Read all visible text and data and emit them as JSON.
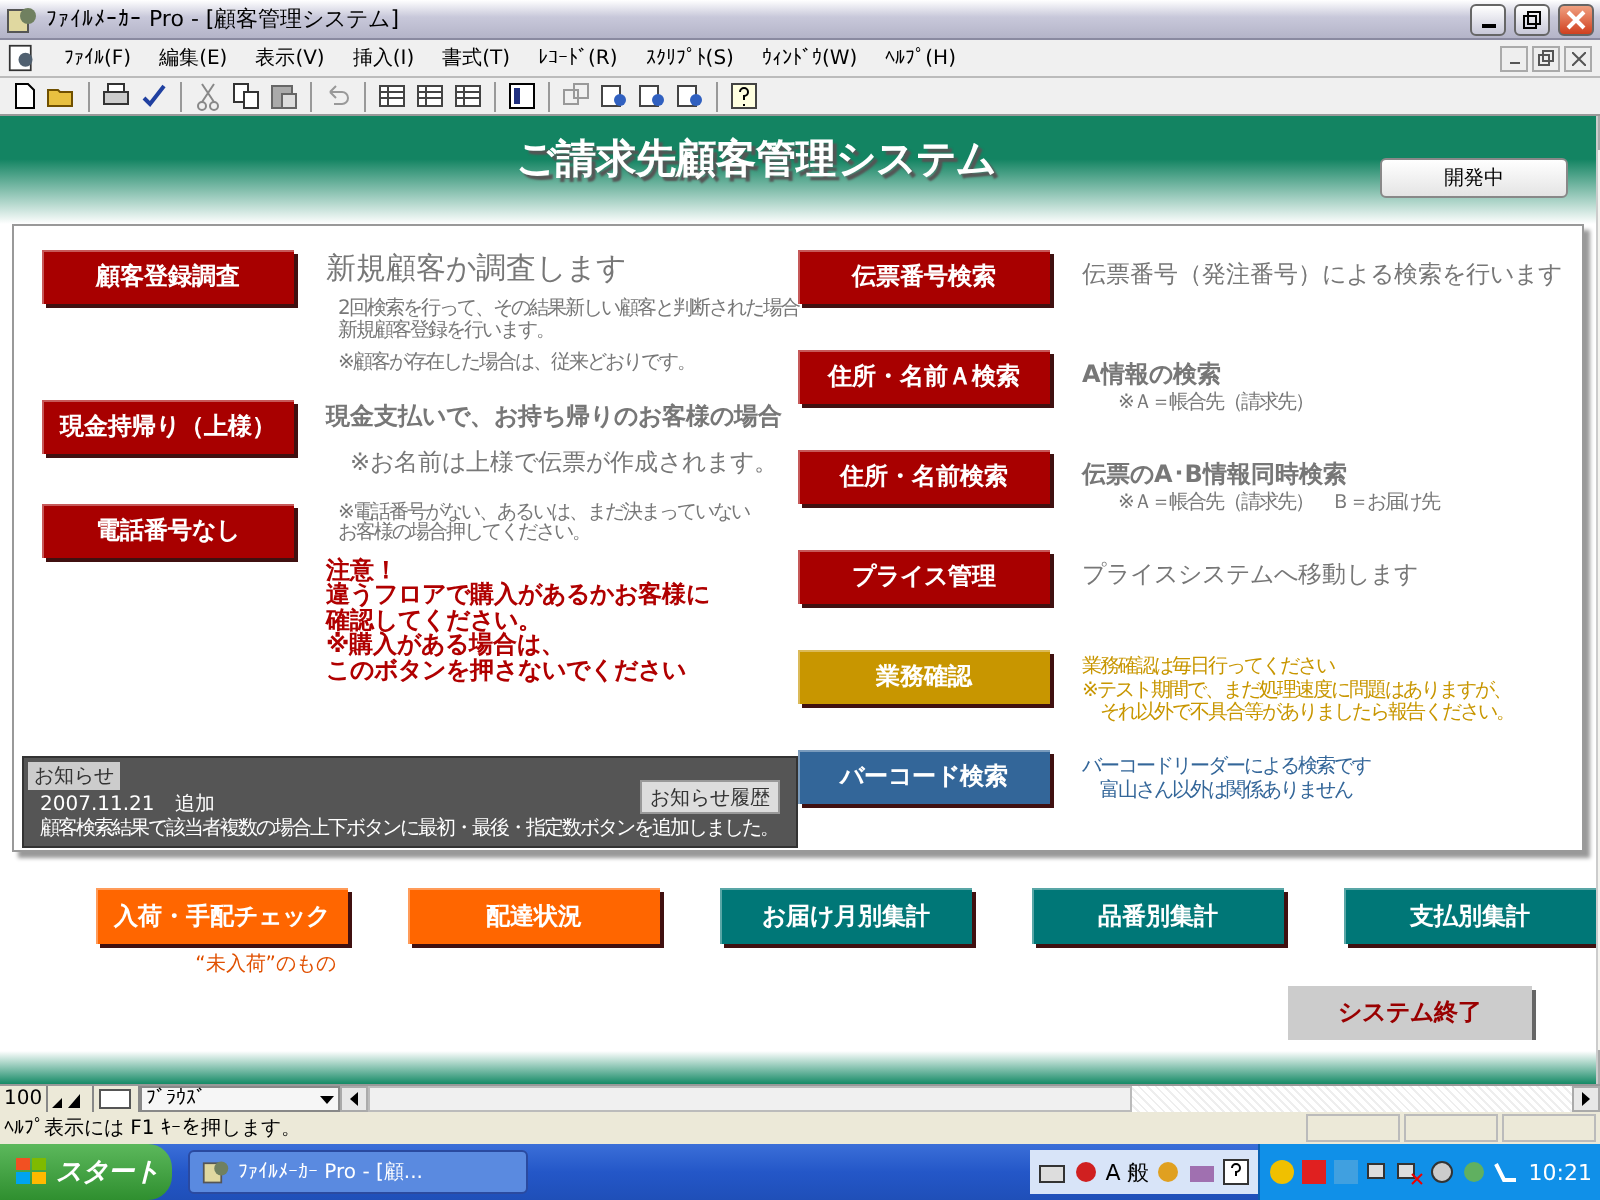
{
  "window": {
    "title": "ﾌｧｲﾙﾒｰｶｰ Pro - [顧客管理システム]"
  },
  "menu": [
    "ﾌｧｲﾙ(F)",
    "編集(E)",
    "表示(V)",
    "挿入(I)",
    "書式(T)",
    "ﾚｺｰﾄﾞ(R)",
    "ｽｸﾘﾌﾟﾄ(S)",
    "ｳｨﾝﾄﾞｳ(W)",
    "ﾍﾙﾌﾟ(H)"
  ],
  "header": {
    "title": "ご請求先顧客管理システム",
    "badge": "開発中"
  },
  "left_items": [
    {
      "label": "顧客登録調査",
      "color": "#a80000",
      "lines": [
        {
          "kind": "lead",
          "text": "新規顧客か調査します"
        },
        {
          "kind": "note",
          "text": "2回検索を行って、その結果新しい顧客と判断された場合"
        },
        {
          "kind": "note-cont",
          "text": "新規顧客登録を行います。"
        },
        {
          "kind": "note",
          "text": "※顧客が存在した場合は、従来どおりです。"
        }
      ]
    },
    {
      "label": "現金持帰り（上様）",
      "color": "#a80000",
      "lines": [
        {
          "kind": "strong",
          "text": "現金支払いで、お持ち帰りのお客様の場合"
        },
        {
          "kind": "plain",
          "text": "　※お名前は上様で伝票が作成されます。"
        }
      ]
    },
    {
      "label": "電話番号なし",
      "color": "#a80000",
      "lines": [
        {
          "kind": "note",
          "text": "※電話番号がない、あるいは、まだ決まっていない"
        },
        {
          "kind": "note-cont",
          "text": "お客様の場合押してください。"
        },
        {
          "kind": "warning",
          "text": "注意！"
        },
        {
          "kind": "warning",
          "text": "違うフロアで購入があるかお客様に"
        },
        {
          "kind": "warning",
          "text": "確認してください。"
        },
        {
          "kind": "warning",
          "text": "※購入がある場合は、"
        },
        {
          "kind": "warning",
          "text": "このボタンを押さないでください"
        }
      ]
    }
  ],
  "notice": {
    "label": "お知らせ",
    "history_button": "お知らせ履歴",
    "date": "2007.11.21　追加",
    "text": "顧客検索結果で該当者複数の場合上下ボタンに最初・最後・指定数ボタンを追加しました。"
  },
  "right_items": [
    {
      "label": "伝票番号検索",
      "color": "#a80000",
      "lines": [
        {
          "kind": "plain",
          "text": "伝票番号（発注番号）による検索を行います"
        }
      ]
    },
    {
      "label": "住所・名前Ａ検索",
      "color": "#a80000",
      "lines": [
        {
          "kind": "strong",
          "text": "A情報の検索"
        },
        {
          "kind": "note",
          "text": "　　※Ａ＝帳合先（請求先）"
        }
      ]
    },
    {
      "label": "住所・名前検索",
      "color": "#a80000",
      "lines": [
        {
          "kind": "strong",
          "text": "伝票のA･B情報同時検索"
        },
        {
          "kind": "note",
          "text": "　　※Ａ＝帳合先（請求先）　Ｂ＝お届け先"
        }
      ]
    },
    {
      "label": "プライス管理",
      "color": "#a80000",
      "lines": [
        {
          "kind": "plain",
          "text": "プライスシステムへ移動します"
        }
      ]
    },
    {
      "label": "業務確認",
      "color": "#c89600",
      "lines": [
        {
          "kind": "accent",
          "text": "業務確認は毎日行ってください"
        },
        {
          "kind": "accent",
          "text": "※テスト期間で、まだ処理速度に問題はありますが、"
        },
        {
          "kind": "accent",
          "text": "　それ以外で不具合等がありましたら報告ください。"
        }
      ]
    },
    {
      "label": "バーコード検索",
      "color": "#336699",
      "lines": [
        {
          "kind": "accent",
          "text": "バーコードリーダーによる検索です"
        },
        {
          "kind": "accent",
          "text": "　富山さん以外は関係ありません"
        }
      ]
    }
  ],
  "bottom_buttons": [
    {
      "label": "入荷・手配チェック",
      "color": "#ff6600",
      "caption": "“未入荷”のもの"
    },
    {
      "label": "配達状況",
      "color": "#ff6600"
    },
    {
      "label": "お届け月別集計",
      "color": "#007777"
    },
    {
      "label": "品番別集計",
      "color": "#007777"
    },
    {
      "label": "支払別集計",
      "color": "#007777"
    }
  ],
  "exit_button": "システム終了",
  "bottom_bar": {
    "zoom": "100",
    "mode": "ﾌﾞﾗｳｽﾞ"
  },
  "status_bar": "ﾍﾙﾌﾟ表示には F1 ｷｰを押します。",
  "taskbar": {
    "start": "スタート",
    "task": "ﾌｧｲﾙﾒｰｶｰ Pro - [顧...",
    "ime": [
      "A",
      "般"
    ],
    "clock": "10:21"
  }
}
